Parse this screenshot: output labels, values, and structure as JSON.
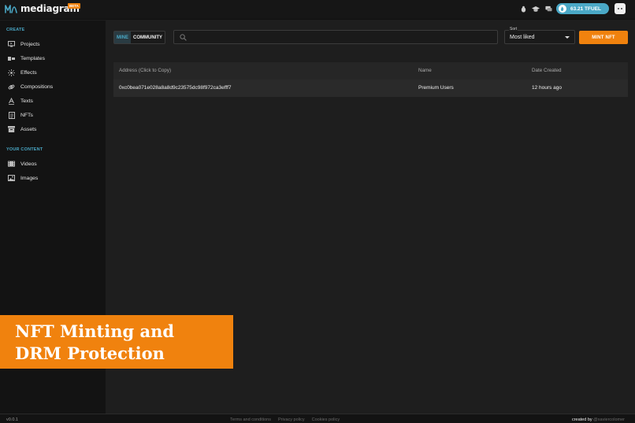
{
  "app": {
    "name": "mediagram",
    "badge": "BETA"
  },
  "topbar": {
    "balance": "63.21 TFUEL"
  },
  "sidebar": {
    "create_title": "CREATE",
    "create_items": [
      {
        "label": "Projects",
        "icon": "monitor-icon"
      },
      {
        "label": "Templates",
        "icon": "templates-icon"
      },
      {
        "label": "Effects",
        "icon": "sparkle-icon"
      },
      {
        "label": "Compositions",
        "icon": "link-icon"
      },
      {
        "label": "Texts",
        "icon": "text-icon"
      },
      {
        "label": "NFTs",
        "icon": "nft-icon"
      },
      {
        "label": "Assets",
        "icon": "archive-icon"
      }
    ],
    "content_title": "YOUR CONTENT",
    "content_items": [
      {
        "label": "Videos",
        "icon": "film-icon"
      },
      {
        "label": "Images",
        "icon": "image-icon"
      }
    ]
  },
  "toolbar": {
    "mine": "MINE",
    "community": "COMMUNITY",
    "search_placeholder": "",
    "sort_label": "Sort",
    "sort_value": "Most liked",
    "mint_button": "MINT NFT"
  },
  "table": {
    "headers": [
      "Address (Click to Copy)",
      "Name",
      "Date Created"
    ],
    "rows": [
      [
        "0xc0bea071e028a8a8d9c23575dc98f972ca3efff7",
        "Premium Users",
        "12 hours ago"
      ]
    ]
  },
  "banner": {
    "line1": "NFT Minting and",
    "line2": "DRM Protection"
  },
  "footer": {
    "version": "v0.0.1",
    "links": [
      "Terms and conditions",
      "Privacy policy",
      "Cookies policy"
    ],
    "created_by": "created by",
    "author": "@xaviercolomer"
  },
  "colors": {
    "accent": "#4aa8c6",
    "brand_orange": "#f0820e",
    "background": "#1e1e1e",
    "sidebar": "#131313"
  }
}
